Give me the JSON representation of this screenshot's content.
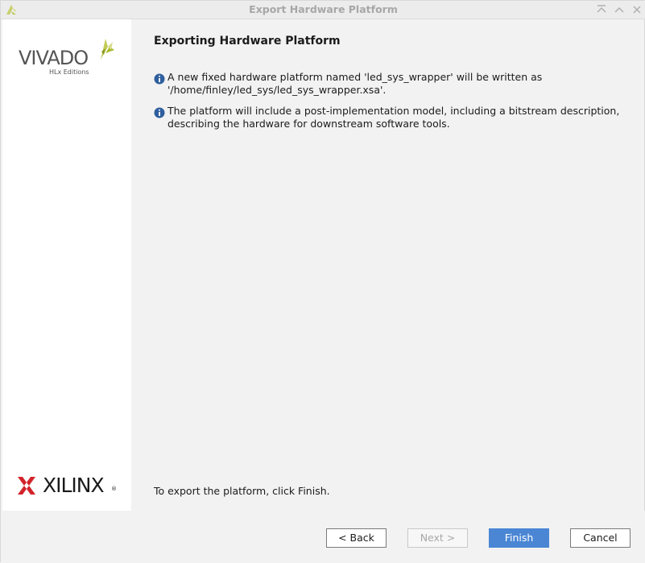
{
  "window": {
    "title": "Export Hardware Platform"
  },
  "sidebar": {
    "vivado_logo": {
      "word": "VIVADO",
      "subtitle": "HLx Editions",
      "icon": "vivado-leaf-icon"
    },
    "xilinx_logo": {
      "word": "XILINX",
      "mark": "®",
      "icon": "xilinx-x-icon"
    }
  },
  "main": {
    "heading": "Exporting Hardware Platform",
    "info": [
      {
        "icon": "info-icon",
        "lines": [
          "A new fixed hardware platform named 'led_sys_wrapper' will be written as",
          "'/home/finley/led_sys/led_sys_wrapper.xsa'."
        ]
      },
      {
        "icon": "info-icon",
        "lines": [
          "The platform will include a post-implementation model, including a bitstream description,",
          "describing the hardware for downstream software tools."
        ]
      }
    ],
    "footer_note": "To export the platform, click Finish."
  },
  "buttons": {
    "back": "< Back",
    "next": "Next >",
    "finish": "Finish",
    "cancel": "Cancel"
  },
  "colors": {
    "primary_button": "#4a86d4",
    "info_icon": "#2f5f9e",
    "xilinx_red": "#d2232a",
    "vivado_green": "#a7b92b"
  }
}
